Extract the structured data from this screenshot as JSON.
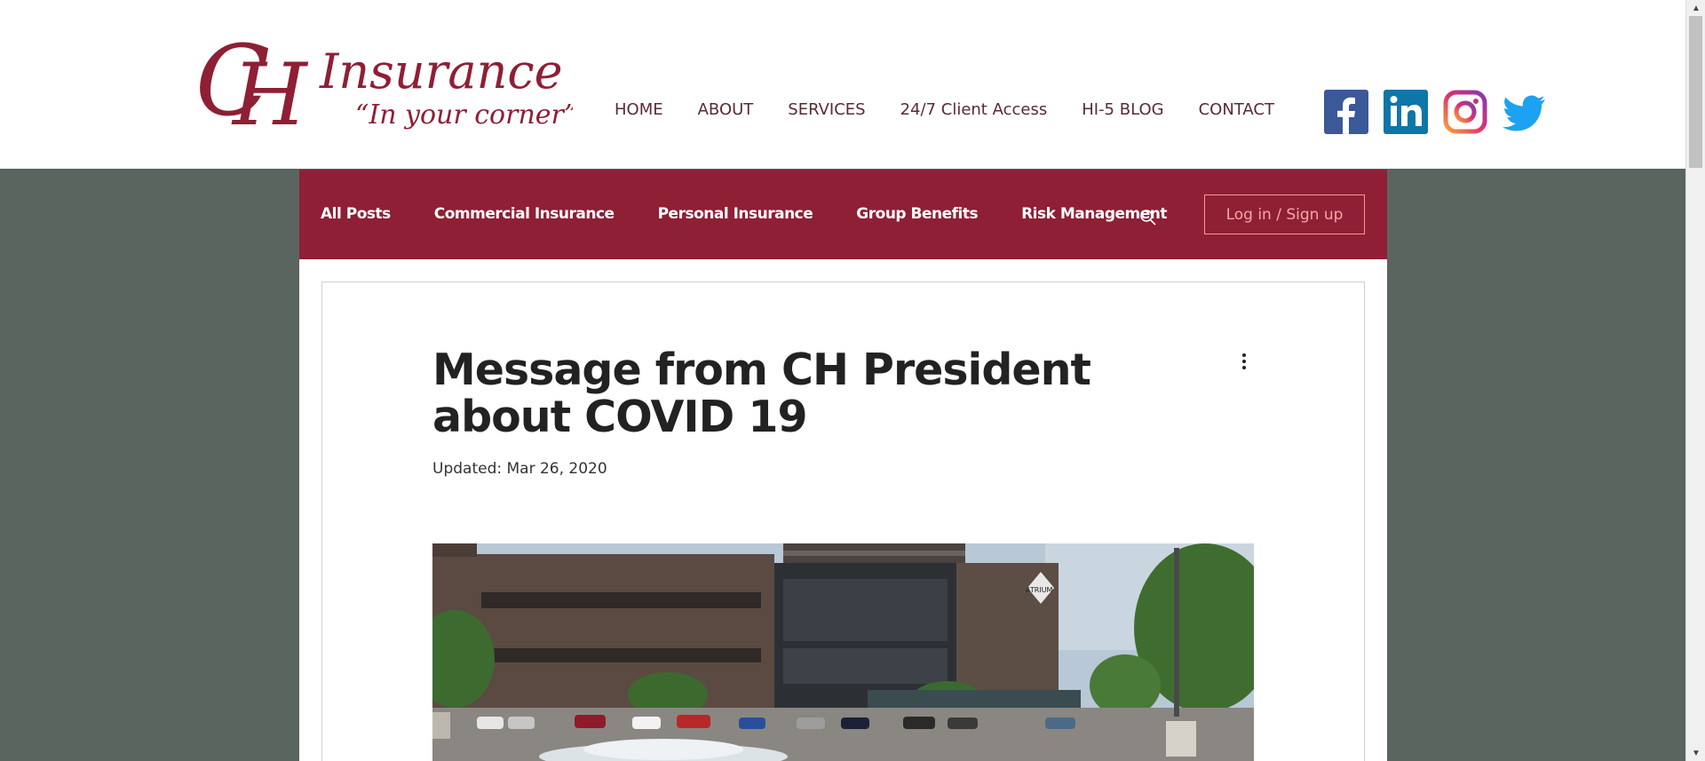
{
  "logo": {
    "mark": "CH",
    "name": "Insurance",
    "tagline": "“In your corner”",
    "brand_color": "#8e1f35"
  },
  "nav": {
    "items": [
      "HOME",
      "ABOUT",
      "SERVICES",
      "24/7 Client Access",
      "HI-5 BLOG",
      "CONTACT"
    ]
  },
  "social": {
    "icons": [
      "facebook-icon",
      "linkedin-icon",
      "instagram-icon",
      "twitter-icon"
    ]
  },
  "blog_bar": {
    "categories": [
      "All Posts",
      "Commercial Insurance",
      "Personal Insurance",
      "Group Benefits",
      "Risk Management"
    ],
    "search_icon": "search-icon",
    "login_label": "Log in / Sign up",
    "bar_color": "#8e1f35"
  },
  "post": {
    "title": "Message from CH President about COVID 19",
    "updated": "Updated: Mar 26, 2020",
    "building_sign": "ATRIUM"
  },
  "colors": {
    "background": "#5b6560",
    "accent": "#8e1f35",
    "login_border": "#f29b97"
  }
}
